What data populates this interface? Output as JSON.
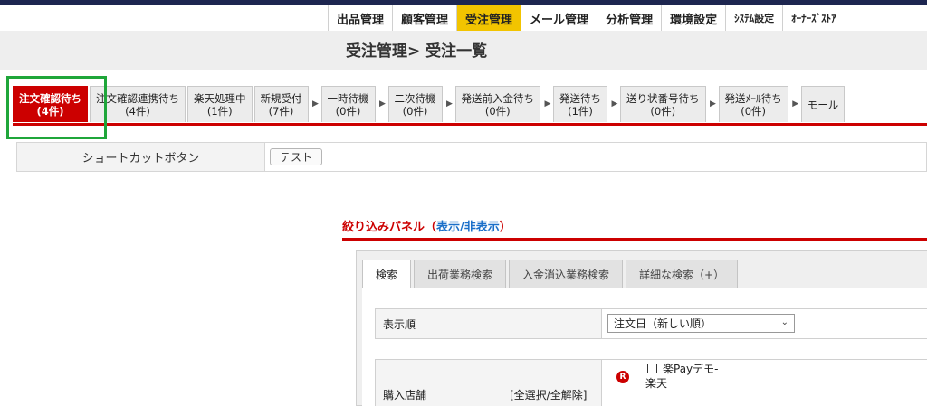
{
  "nav": {
    "items": [
      {
        "label": "出品管理",
        "active": false
      },
      {
        "label": "顧客管理",
        "active": false
      },
      {
        "label": "受注管理",
        "active": true
      },
      {
        "label": "メール管理",
        "active": false
      },
      {
        "label": "分析管理",
        "active": false
      },
      {
        "label": "環境設定",
        "active": false
      },
      {
        "label": "ｼｽﾃﾑ設定",
        "active": false
      },
      {
        "label": "ｵｰﾅｰｽﾞｽﾄｱ",
        "active": false
      }
    ]
  },
  "page_title": "受注管理> 受注一覧",
  "status_tabs": [
    {
      "label": "注文確認待ち",
      "count": "(4件)"
    },
    {
      "label": "注文確認連携待ち",
      "count": "(4件)"
    },
    {
      "label": "楽天処理中",
      "count": "(1件)"
    },
    {
      "label": "新規受付",
      "count": "(7件)"
    },
    {
      "label": "一時待機",
      "count": "(0件)"
    },
    {
      "label": "二次待機",
      "count": "(0件)"
    },
    {
      "label": "発送前入金待ち",
      "count": "(0件)"
    },
    {
      "label": "発送待ち",
      "count": "(1件)"
    },
    {
      "label": "送り状番号待ち",
      "count": "(0件)"
    },
    {
      "label": "発送ﾒｰﾙ待ち",
      "count": "(0件)"
    },
    {
      "label": "モール",
      "count": ""
    }
  ],
  "shortcut": {
    "label": "ショートカットボタン",
    "test_button": "テスト"
  },
  "filter": {
    "title": "絞り込みパネル（",
    "show": "表示",
    "sep": "/",
    "hide": "非表示",
    "close": "）"
  },
  "panel_tabs": [
    "検索",
    "出荷業務検索",
    "入金消込業務検索",
    "詳細な検索（+）"
  ],
  "sort": {
    "label": "表示順",
    "selected": "注文日（新しい順）"
  },
  "store": {
    "label": "購入店舗",
    "select_all": "[全選択/全解除]",
    "badge": "R",
    "shop_line1": "楽Payデモ-",
    "shop_line2": "楽天"
  },
  "colors": {
    "accent_red": "#cc0000",
    "nav_active": "#f2c400",
    "highlight_green": "#1fa63a",
    "link_blue": "#1a6fc9"
  }
}
